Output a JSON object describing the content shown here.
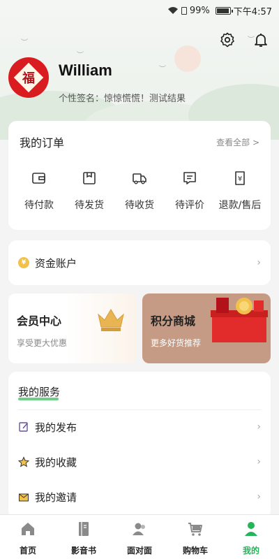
{
  "status_bar": {
    "battery": "99%",
    "time": "下午4:57"
  },
  "profile": {
    "name": "William",
    "avatar_glyph": "福",
    "signature": "个性签名：惊惊慌慌！测试结果"
  },
  "orders": {
    "title": "我的订单",
    "view_all": "查看全部 >",
    "items": [
      {
        "label": "待付款",
        "icon": "wallet-icon"
      },
      {
        "label": "待发货",
        "icon": "package-icon"
      },
      {
        "label": "待收货",
        "icon": "truck-icon"
      },
      {
        "label": "待评价",
        "icon": "comment-icon"
      },
      {
        "label": "退款/售后",
        "icon": "refund-icon"
      }
    ]
  },
  "account": {
    "label": "资金账户",
    "coin_symbol": "¥"
  },
  "member": {
    "title": "会员中心",
    "subtitle": "享受更大优惠"
  },
  "points_mall": {
    "title": "积分商城",
    "subtitle": "更多好货推荐"
  },
  "services": {
    "title": "我的服务",
    "items": [
      {
        "label": "我的发布",
        "icon": "edit-icon"
      },
      {
        "label": "我的收藏",
        "icon": "star-icon"
      },
      {
        "label": "我的邀请",
        "icon": "mail-icon"
      }
    ]
  },
  "tabbar": {
    "items": [
      {
        "label": "首页",
        "icon": "home-icon",
        "active": false
      },
      {
        "label": "影音书",
        "icon": "book-icon",
        "active": false
      },
      {
        "label": "面对面",
        "icon": "people-icon",
        "active": false
      },
      {
        "label": "购物车",
        "icon": "cart-icon",
        "active": false
      },
      {
        "label": "我的",
        "icon": "user-icon",
        "active": true
      }
    ]
  },
  "colors": {
    "accent": "#25b45a",
    "avatar_red": "#d91c1f",
    "coin": "#f2c14b"
  }
}
